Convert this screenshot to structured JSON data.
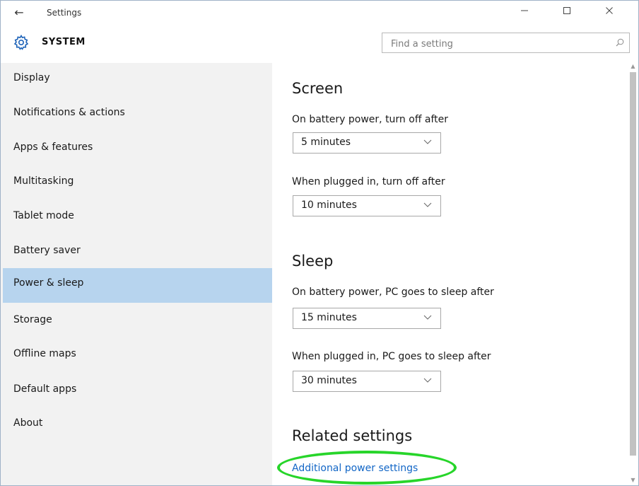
{
  "window": {
    "back_glyph": "←",
    "title": "Settings",
    "minimize_glyph": "—",
    "maximize_glyph": "☐",
    "close_glyph": "✕"
  },
  "header": {
    "icon": "gear-icon",
    "section_title": "SYSTEM",
    "search_placeholder": "Find a setting"
  },
  "sidebar": {
    "items": [
      {
        "label": "Display",
        "active": false
      },
      {
        "label": "Notifications & actions",
        "active": false
      },
      {
        "label": "Apps & features",
        "active": false
      },
      {
        "label": "Multitasking",
        "active": false
      },
      {
        "label": "Tablet mode",
        "active": false
      },
      {
        "label": "Battery saver",
        "active": false
      },
      {
        "label": "Power & sleep",
        "active": true
      },
      {
        "label": "Storage",
        "active": false
      },
      {
        "label": "Offline maps",
        "active": false
      },
      {
        "label": "Default apps",
        "active": false
      },
      {
        "label": "About",
        "active": false
      }
    ]
  },
  "main": {
    "screen": {
      "heading": "Screen",
      "battery_label": "On battery power, turn off after",
      "battery_value": "5 minutes",
      "plugged_label": "When plugged in, turn off after",
      "plugged_value": "10 minutes"
    },
    "sleep": {
      "heading": "Sleep",
      "battery_label": "On battery power, PC goes to sleep after",
      "battery_value": "15 minutes",
      "plugged_label": "When plugged in, PC goes to sleep after",
      "plugged_value": "30 minutes"
    },
    "related": {
      "heading": "Related settings",
      "link": "Additional power settings"
    }
  },
  "colors": {
    "accent_selection": "#b7d4ee",
    "link": "#1266c6",
    "highlight_ring": "#27d52a"
  }
}
